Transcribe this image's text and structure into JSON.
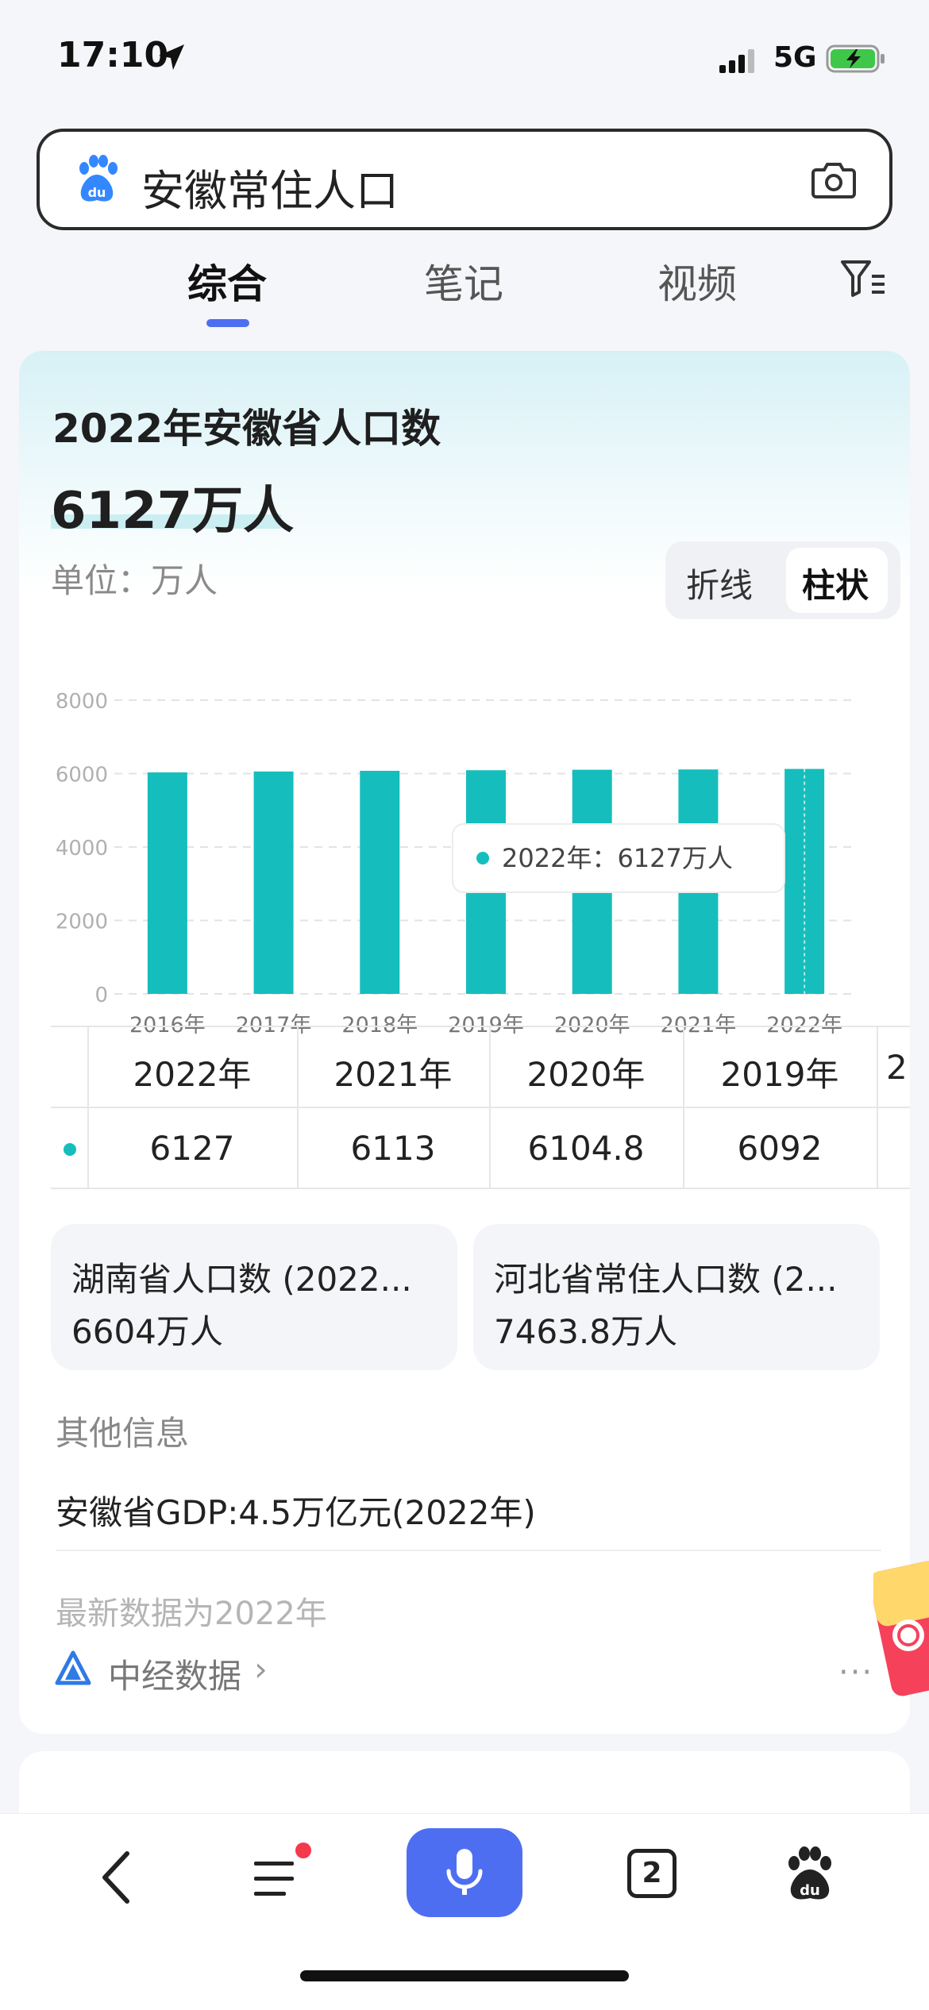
{
  "status_bar": {
    "time": "17:10",
    "network": "5G"
  },
  "search": {
    "query": "安徽常住人口"
  },
  "tabs": [
    {
      "label": "综合"
    },
    {
      "label": "笔记"
    },
    {
      "label": "视频"
    }
  ],
  "card": {
    "title": "2022年安徽省人口数",
    "value": "6127万人",
    "unit_label": "单位：万人",
    "toggle": [
      "折线",
      "柱状"
    ],
    "toggle_selected": "柱状"
  },
  "chart_data": {
    "type": "bar",
    "categories": [
      "2016年",
      "2017年",
      "2018年",
      "2019年",
      "2020年",
      "2021年",
      "2022年"
    ],
    "values": [
      6033,
      6057,
      6076,
      6092,
      6104.8,
      6113,
      6127
    ],
    "ylim": [
      0,
      8000
    ],
    "yticks": [
      "0",
      "2000",
      "4000",
      "6000",
      "8000"
    ],
    "color": "#15bebc",
    "grid": true,
    "tooltip": "2022年：6127万人"
  },
  "table": {
    "headers": [
      "2022年",
      "2021年",
      "2020年",
      "2019年",
      "2"
    ],
    "values": [
      "6127",
      "6113",
      "6104.8",
      "6092",
      ""
    ]
  },
  "related": [
    {
      "title": "湖南省人口数 (2022...",
      "value": "6604万人"
    },
    {
      "title": "河北省常住人口数 (2...",
      "value": "7463.8万人"
    }
  ],
  "other": {
    "title": "其他信息",
    "item": "安徽省GDP:4.5万亿元(2022年)",
    "latest": "最新数据为2022年",
    "source": "中经数据",
    "more": "···"
  },
  "bottom_bar": {
    "tab_count": "2"
  },
  "accent_color": "#4e6ef2"
}
